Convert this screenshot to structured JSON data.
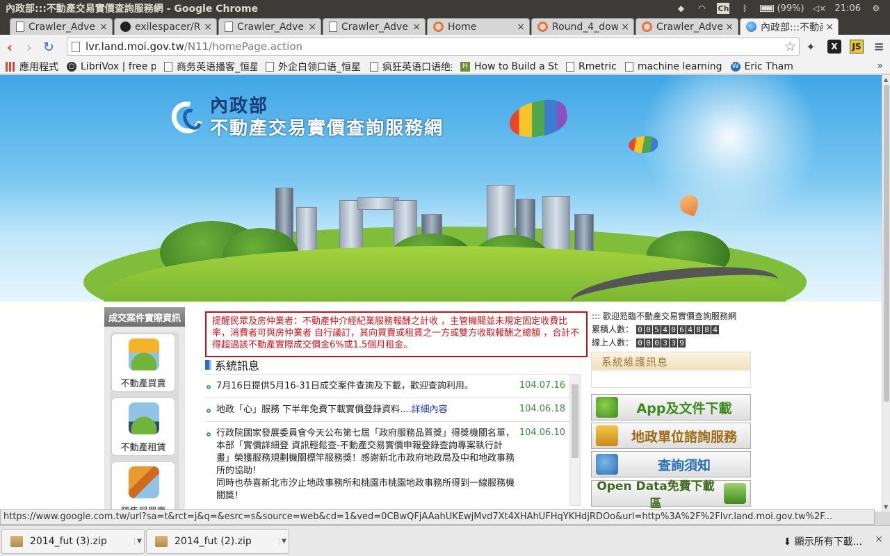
{
  "os": {
    "window_title": "內政部:::不動產交易實價查詢服務網 - Google Chrome",
    "battery": "(99%)",
    "time": "21:06",
    "input_method": "Ch"
  },
  "tabs": [
    {
      "label": "Crawler_Adve",
      "icon": "document-icon"
    },
    {
      "label": "exilespacer/R",
      "icon": "github-icon"
    },
    {
      "label": "Crawler_Adve",
      "icon": "document-icon"
    },
    {
      "label": "Crawler_Adve",
      "icon": "document-icon"
    },
    {
      "label": "Home",
      "icon": "ring-icon"
    },
    {
      "label": "Round_4_dow",
      "icon": "ring-icon"
    },
    {
      "label": "Crawler_Adve",
      "icon": "ring-icon"
    },
    {
      "label": "內政部:::不動產",
      "icon": "moi-icon",
      "active": true
    }
  ],
  "toolbar": {
    "url_host": "lvr.land.moi.gov.tw",
    "url_path": "/N11/homePage.action",
    "ext_x": "X",
    "ext_js": "JS"
  },
  "bookmarks": [
    {
      "label": "應用程式",
      "icon": "apps-grid-icon"
    },
    {
      "label": "LibriVox | free pu",
      "icon": "librivox-icon"
    },
    {
      "label": "商务英语播客_恒星",
      "icon": "document-icon"
    },
    {
      "label": "外企白领口语_恒星",
      "icon": "document-icon"
    },
    {
      "label": "疯狂英语口语绝招",
      "icon": "document-icon"
    },
    {
      "label": "How to Build a St",
      "icon": "h-icon"
    },
    {
      "label": "Rmetric",
      "icon": "document-icon"
    },
    {
      "label": "machine learning",
      "icon": "document-icon"
    },
    {
      "label": "Eric Tham",
      "icon": "wordpress-icon"
    }
  ],
  "banner": {
    "ministry": "內政部",
    "site_name": "不動產交易實價查詢服務網"
  },
  "sidebar": {
    "heading": "成交案件實際資訊",
    "items": [
      {
        "label": "不動產買賣"
      },
      {
        "label": "不動產租賃"
      },
      {
        "label": "預售屋買賣"
      }
    ]
  },
  "notice": "提醒民眾及房仲業者：不動產仲介經紀業服務報酬之計收 ，主管機關並未規定固定收費比率，消費者可與房仲業者 自行議訂，其向買賣或租賃之一方或雙方收取報酬之總額 ，合計不得超過該不動產實際成交價金6%或1.5個月租金。",
  "system": {
    "heading": "系統訊息",
    "items": [
      {
        "text": "7月16日提供5月16-31日成交案件查詢及下載，歡迎查詢利用。",
        "link": "",
        "date": "104.07.16"
      },
      {
        "text": "地政「心」服務 下半年免費下載實價登錄資料....",
        "link": "詳細內容",
        "date": "104.06.18"
      },
      {
        "text": "行政院國家發展委員會今天公布第七屆「政府服務品質獎」得獎機關名單，本部「實價詳細登 資訊輕鬆查-不動產交易實價申報登錄查詢專案執行計畫」榮獲服務規劃機關標竿服務獎！感謝新北市政府地政局及中和地政事務所的協助！",
        "text2": "同時也恭喜新北市汐止地政事務所和桃園市桃園地政事務所得到一線服務機關獎！",
        "link": "",
        "date": "104.06.10"
      }
    ]
  },
  "welcome": {
    "text": "::: 歡迎蒞臨不動產交易實價查詢服務網",
    "total_label": "累積人數：",
    "total_digits": [
      "0",
      "0",
      "5",
      "4",
      "0",
      "6",
      "4",
      "8",
      "8",
      "4"
    ],
    "online_label": "線上人數：",
    "online_digits": [
      "0",
      "0",
      "0",
      "3",
      "3",
      "9"
    ]
  },
  "maintenance": {
    "heading": "系統維護訊息"
  },
  "buttons": {
    "app": "App及文件下載",
    "land": "地政單位諮詢服務",
    "query": "查詢須知",
    "open": "Open Data免費下載區"
  },
  "status_url": "https://www.google.com.tw/url?sa=t&rct=j&q=&esrc=s&source=web&cd=1&ved=0CBwQFjAAahUKEwjMvd7Xt4XHAhUFHqYKHdjRDOo&url=http%3A%2F%2Flvr.land.moi.gov.tw%2F...",
  "downloads": {
    "items": [
      {
        "label": "2014_fut (3).zip"
      },
      {
        "label": "2014_fut (2).zip"
      }
    ],
    "show_all": "顯示所有下載...",
    "close": "×"
  },
  "colors": {
    "notice_border": "#c0101a",
    "link": "#1a35c9",
    "date": "#3c8a3c"
  }
}
